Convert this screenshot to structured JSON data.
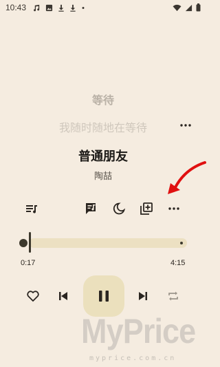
{
  "status_bar": {
    "time": "10:43",
    "left_icons": [
      "music-note-icon",
      "image-icon",
      "download-icon",
      "download-icon",
      "dot-icon"
    ],
    "right_icons": [
      "wifi-icon",
      "signal-icon",
      "battery-icon"
    ]
  },
  "lyrics": {
    "current_line": "等待",
    "next_line": "我随时随地在等待"
  },
  "song": {
    "title": "普通朋友",
    "artist": "陶喆"
  },
  "toolbar": {
    "icons": [
      "playlist-icon",
      "lyrics-icon",
      "sleep-timer-icon",
      "add-to-playlist-icon",
      "more-icon"
    ]
  },
  "progress": {
    "current_time": "0:17",
    "total_time": "4:15",
    "fraction": 0.067
  },
  "controls": {
    "icons": [
      "favorite-icon",
      "previous-icon",
      "pause-icon",
      "next-icon",
      "repeat-icon"
    ]
  },
  "watermark": {
    "brand": "MyPrice",
    "url": "myprice.com.cn"
  },
  "colors": {
    "background": "#f5ece0",
    "accent": "#ebe0bd",
    "annotation_arrow": "#e01010"
  }
}
